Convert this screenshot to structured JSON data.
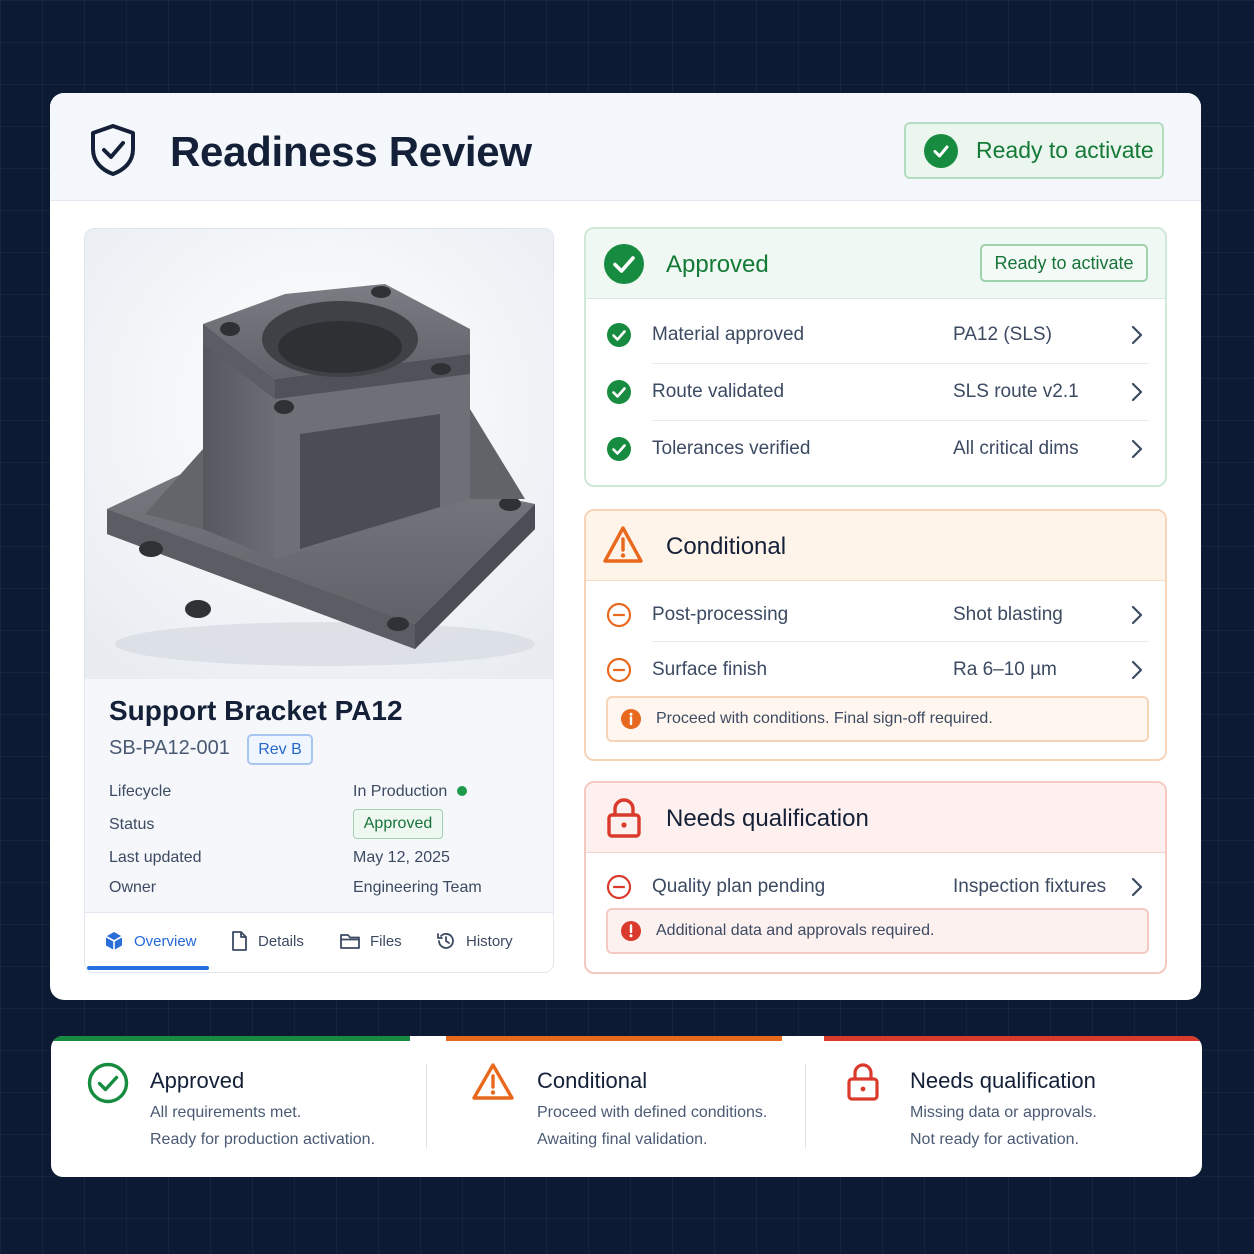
{
  "header": {
    "title": "Readiness Review",
    "status_label": "Ready to activate",
    "shield_icon": "shield-check-icon"
  },
  "product": {
    "name": "Support Bracket PA12",
    "part_number": "SB-PA12-001",
    "revision": "Rev B",
    "meta": {
      "lifecycle_label": "Lifecycle",
      "lifecycle_value": "In Production",
      "status_label": "Status",
      "status_value": "Approved",
      "updated_label": "Last updated",
      "updated_value": "May 12, 2025",
      "owner_label": "Owner",
      "owner_value": "Engineering Team"
    },
    "tabs": [
      {
        "label": "Overview",
        "icon": "cube-icon",
        "active": true
      },
      {
        "label": "Details",
        "icon": "document-icon",
        "active": false
      },
      {
        "label": "Files",
        "icon": "folder-icon",
        "active": false
      },
      {
        "label": "History",
        "icon": "history-icon",
        "active": false
      }
    ]
  },
  "approved_panel": {
    "title": "Approved",
    "badge": "Ready to activate",
    "color": "#178b3f",
    "items": [
      {
        "label": "Material approved",
        "value": "PA12 (SLS)"
      },
      {
        "label": "Route validated",
        "value": "SLS route v2.1"
      },
      {
        "label": "Tolerances verified",
        "value": "All critical dims"
      }
    ]
  },
  "conditional_panel": {
    "title": "Conditional",
    "color": "#e8681d",
    "items": [
      {
        "label": "Post-processing",
        "value": "Shot blasting"
      },
      {
        "label": "Surface finish",
        "value": "Ra 6–10 µm"
      }
    ],
    "note": "Proceed with conditions. Final sign-off required."
  },
  "needs_panel": {
    "title": "Needs qualification",
    "color": "#d93a2b",
    "items": [
      {
        "label": "Quality plan pending",
        "value": "Inspection fixtures"
      }
    ],
    "note": "Additional data and approvals required."
  },
  "legend": [
    {
      "title": "Approved",
      "line1": "All requirements met.",
      "line2": "Ready for production activation.",
      "color": "#178b3f",
      "icon": "check-circle-icon"
    },
    {
      "title": "Conditional",
      "line1": "Proceed with defined conditions.",
      "line2": "Awaiting final validation.",
      "color": "#e8681d",
      "icon": "warning-triangle-icon"
    },
    {
      "title": "Needs qualification",
      "line1": "Missing data or approvals.",
      "line2": "Not ready for activation.",
      "color": "#d93a2b",
      "icon": "lock-icon"
    }
  ]
}
